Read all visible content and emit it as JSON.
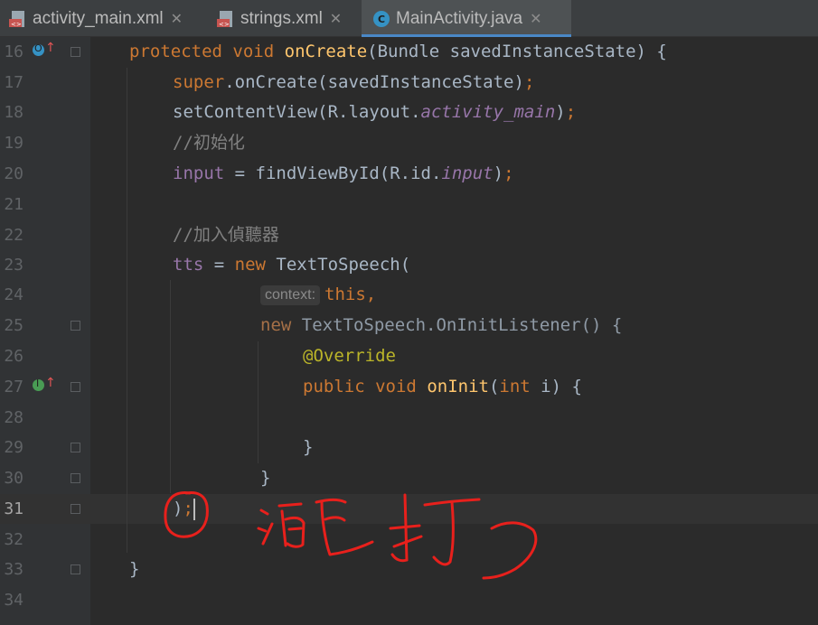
{
  "tabs": [
    {
      "label": "activity_main.xml",
      "icon": "xml-file-icon",
      "active": false
    },
    {
      "label": "strings.xml",
      "icon": "xml-file-icon",
      "active": false
    },
    {
      "label": "MainActivity.java",
      "icon": "java-class-icon",
      "active": true
    }
  ],
  "tab_close_glyph": "✕",
  "class_icon_letter": "C",
  "colors": {
    "background": "#2b2b2b",
    "keyword": "#cc7832",
    "method_decl": "#ffc66d",
    "field": "#9876aa",
    "comment": "#808080",
    "annotation": "#bbb529",
    "annotation_ink": "#e8201c"
  },
  "lines": {
    "l16": {
      "num": "16",
      "kw1": "protected",
      "kw2": "void",
      "fn": "onCreate",
      "rest": "(Bundle savedInstanceState) {"
    },
    "l17": {
      "num": "17",
      "kw": "super",
      "rest": ".onCreate(savedInstanceState)",
      "semi": ";"
    },
    "l18": {
      "num": "18",
      "a": "setContentView(R.layout.",
      "ital": "activity_main",
      "b": ")",
      "semi": ";"
    },
    "l19": {
      "num": "19",
      "comment": "//初始化"
    },
    "l20": {
      "num": "20",
      "field": "input",
      "a": " = findViewById(R.id.",
      "ital": "input",
      "b": ")",
      "semi": ";"
    },
    "l21": {
      "num": "21"
    },
    "l22": {
      "num": "22",
      "comment": "//加入偵聽器"
    },
    "l23": {
      "num": "23",
      "field": "tts",
      "a": " = ",
      "kw": "new",
      "b": " TextToSpeech("
    },
    "l24": {
      "num": "24",
      "hint": "context:",
      "kw": "this,"
    },
    "l25": {
      "num": "25",
      "kw": "new",
      "rest": " TextToSpeech.OnInitListener() {"
    },
    "l26": {
      "num": "26",
      "ann": "@Override"
    },
    "l27": {
      "num": "27",
      "kw1": "public",
      "kw2": "void",
      "fn": "onInit",
      "a": "(",
      "kw3": "int",
      "b": " i) {"
    },
    "l28": {
      "num": "28"
    },
    "l29": {
      "num": "29",
      "text": "}"
    },
    "l30": {
      "num": "30",
      "text": "}"
    },
    "l31": {
      "num": "31",
      "text": ")",
      "semi": ";"
    },
    "l32": {
      "num": "32"
    },
    "l33": {
      "num": "33",
      "text": "}"
    },
    "l34": {
      "num": "34"
    }
  },
  "gutter_icons": {
    "override_marker": "override-up-arrow-icon",
    "implement_marker": "implement-up-arrow-icon",
    "letter_o": "O",
    "letter_i": "I",
    "arrow": "↑"
  }
}
